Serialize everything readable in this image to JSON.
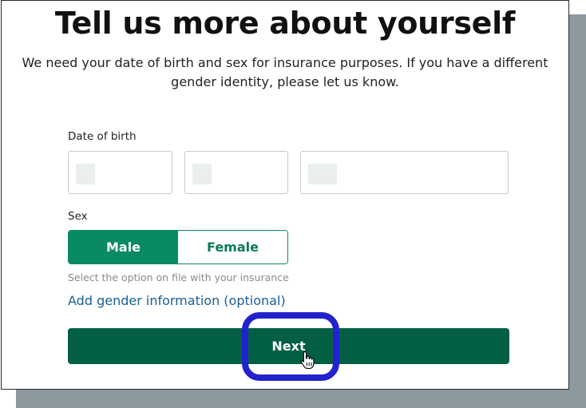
{
  "page": {
    "title": "Tell us more about yourself",
    "subtitle": "We need your date of birth and sex for insurance purposes. If you have a different gender identity, please let us know."
  },
  "dob": {
    "label": "Date of birth",
    "month_value": "",
    "day_value": "",
    "year_value": ""
  },
  "sex": {
    "label": "Sex",
    "options": [
      "Male",
      "Female"
    ],
    "selected": "Male",
    "hint": "Select the option on file with your insurance"
  },
  "gender_link": "Add gender information (optional)",
  "next_button": "Next",
  "colors": {
    "primary_green": "#0a8a63",
    "button_dark_green": "#035f44",
    "link_blue": "#1a5f93",
    "highlight_blue": "#2222cc"
  },
  "icons": {
    "cursor": "hand-pointer-icon"
  }
}
